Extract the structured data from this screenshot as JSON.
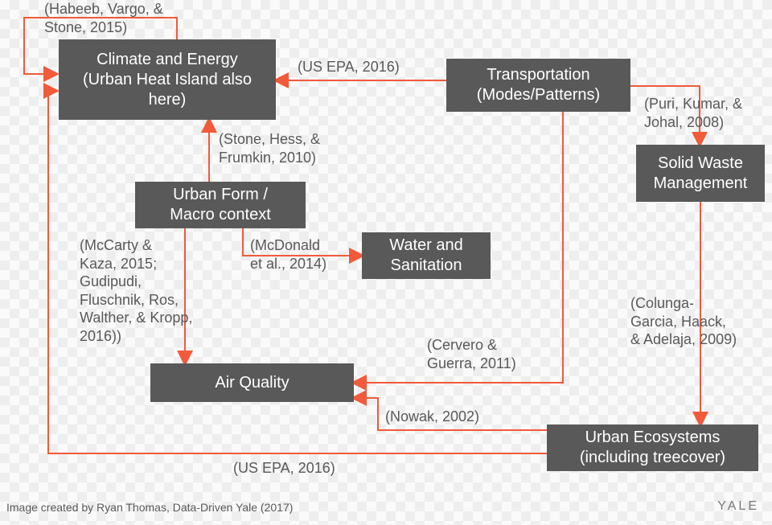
{
  "nodes": {
    "climate": "Climate and Energy\n(Urban Heat Island also\nhere)",
    "transportation": "Transportation\n(Modes/Patterns)",
    "solidWaste": "Solid Waste\nManagement",
    "urbanForm": "Urban Form /\nMacro context",
    "waterSan": "Water and\nSanitation",
    "airQuality": "Air Quality",
    "urbanEco": "Urban Ecosystems\n(including treecover)"
  },
  "labels": {
    "habeeb": "(Habeeb, Vargo, &\nStone, 2015)",
    "usepa1": "(US EPA, 2016)",
    "puri": "(Puri, Kumar, &\nJohal, 2008)",
    "stone": "(Stone, Hess, &\nFrumkin, 2010)",
    "mccarty": "(McCarty &\nKaza, 2015;\nGudipudi,\nFluschnik, Ros,\nWalther, & Kropp,\n2016))",
    "mcdonald": "(McDonald\net al., 2014)",
    "cervero": "(Cervero &\nGuerra, 2011)",
    "colunga": "(Colunga-\nGarcia, Haack,\n& Adelaja, 2009)",
    "nowak": "(Nowak, 2002)",
    "usepa2": "(US EPA, 2016)"
  },
  "credit": "Image created by Ryan Thomas, Data-Driven Yale (2017)",
  "logo": "YALE"
}
